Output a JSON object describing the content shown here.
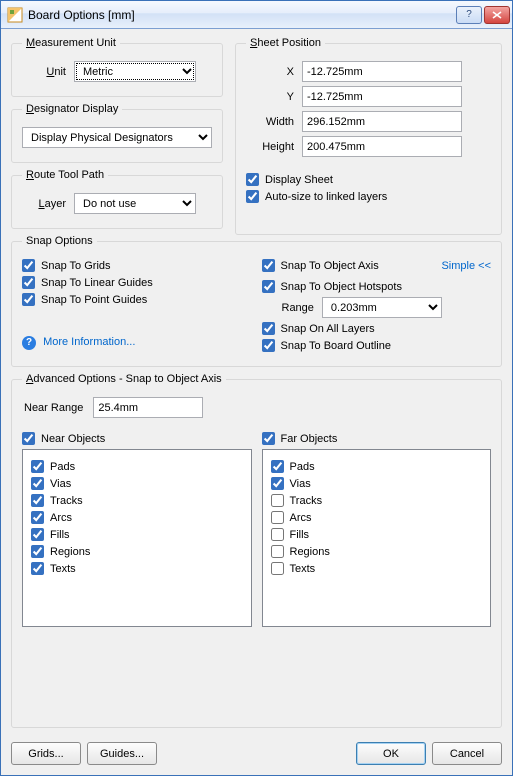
{
  "window": {
    "title": "Board Options [mm]"
  },
  "measurement": {
    "legend": "Measurement Unit",
    "unit_label": "Unit",
    "unit_value": "Metric"
  },
  "designator": {
    "legend": "Designator Display",
    "value": "Display Physical Designators"
  },
  "route": {
    "legend": "Route Tool Path",
    "layer_label": "Layer",
    "layer_value": "Do not use"
  },
  "sheet": {
    "legend": "Sheet Position",
    "x_label": "X",
    "x_value": "-12.725mm",
    "y_label": "Y",
    "y_value": "-12.725mm",
    "width_label": "Width",
    "width_value": "296.152mm",
    "height_label": "Height",
    "height_value": "200.475mm",
    "display_sheet": "Display Sheet",
    "auto_size": "Auto-size to linked layers"
  },
  "snap": {
    "legend": "Snap Options",
    "grids": "Snap To Grids",
    "linear": "Snap To Linear Guides",
    "point": "Snap To Point Guides",
    "object_axis": "Snap To Object Axis",
    "object_hotspots": "Snap To Object Hotspots",
    "range_label": "Range",
    "range_value": "0.203mm",
    "all_layers": "Snap On All Layers",
    "board_outline": "Snap To Board Outline",
    "more_info": "More Information...",
    "simple": "Simple <<"
  },
  "advanced": {
    "legend": "Advanced Options - Snap to Object Axis",
    "near_range_label": "Near Range",
    "near_range_value": "25.4mm",
    "near_header": "Near Objects",
    "far_header": "Far Objects",
    "near": {
      "pads": {
        "label": "Pads",
        "checked": true
      },
      "vias": {
        "label": "Vias",
        "checked": true
      },
      "tracks": {
        "label": "Tracks",
        "checked": true
      },
      "arcs": {
        "label": "Arcs",
        "checked": true
      },
      "fills": {
        "label": "Fills",
        "checked": true
      },
      "regions": {
        "label": "Regions",
        "checked": true
      },
      "texts": {
        "label": "Texts",
        "checked": true
      }
    },
    "far": {
      "pads": {
        "label": "Pads",
        "checked": true
      },
      "vias": {
        "label": "Vias",
        "checked": true
      },
      "tracks": {
        "label": "Tracks",
        "checked": false
      },
      "arcs": {
        "label": "Arcs",
        "checked": false
      },
      "fills": {
        "label": "Fills",
        "checked": false
      },
      "regions": {
        "label": "Regions",
        "checked": false
      },
      "texts": {
        "label": "Texts",
        "checked": false
      }
    }
  },
  "footer": {
    "grids": "Grids...",
    "guides": "Guides...",
    "ok": "OK",
    "cancel": "Cancel"
  }
}
